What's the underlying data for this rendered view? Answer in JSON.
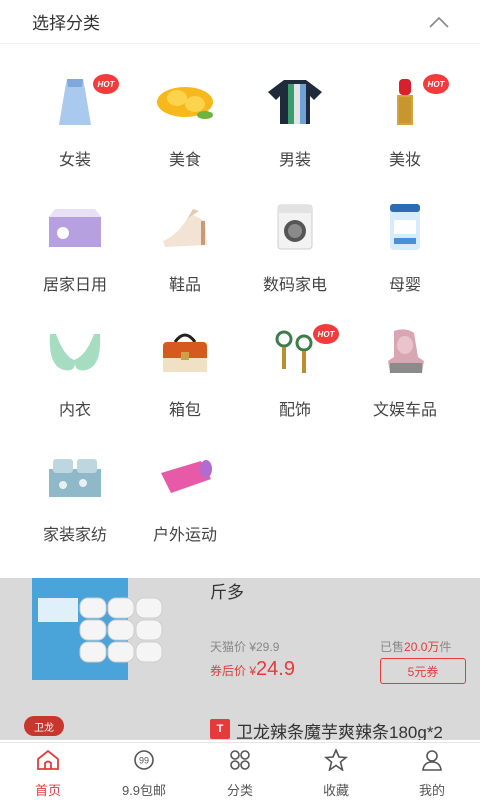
{
  "header": {
    "title": "选择分类"
  },
  "categories": [
    {
      "label": "女装",
      "hot": "HOT"
    },
    {
      "label": "美食"
    },
    {
      "label": "男装"
    },
    {
      "label": "美妆",
      "hot": "HOT"
    },
    {
      "label": "居家日用"
    },
    {
      "label": "鞋品"
    },
    {
      "label": "数码家电"
    },
    {
      "label": "母婴"
    },
    {
      "label": "内衣"
    },
    {
      "label": "箱包"
    },
    {
      "label": "配饰",
      "hot": "HOT"
    },
    {
      "label": "文娱车品"
    },
    {
      "label": "家装家纺"
    },
    {
      "label": "户外运动"
    }
  ],
  "product": {
    "title_tail": "斤多",
    "tmall_price": "天猫价 ¥29.9",
    "sold_prefix": "已售",
    "sold_count": "20.0万",
    "sold_suffix": "件",
    "after_label": "券后价 ¥",
    "after_price": "24.9",
    "coupon": "5元券",
    "brand": "卫龙",
    "badge": "T",
    "next_title": "卫龙辣条魔芋爽辣条180g*2"
  },
  "tabs": [
    {
      "label": "首页",
      "active": true
    },
    {
      "label": "9.9包邮"
    },
    {
      "label": "分类"
    },
    {
      "label": "收藏"
    },
    {
      "label": "我的"
    }
  ],
  "colors": {
    "accent": "#e63a3a"
  }
}
